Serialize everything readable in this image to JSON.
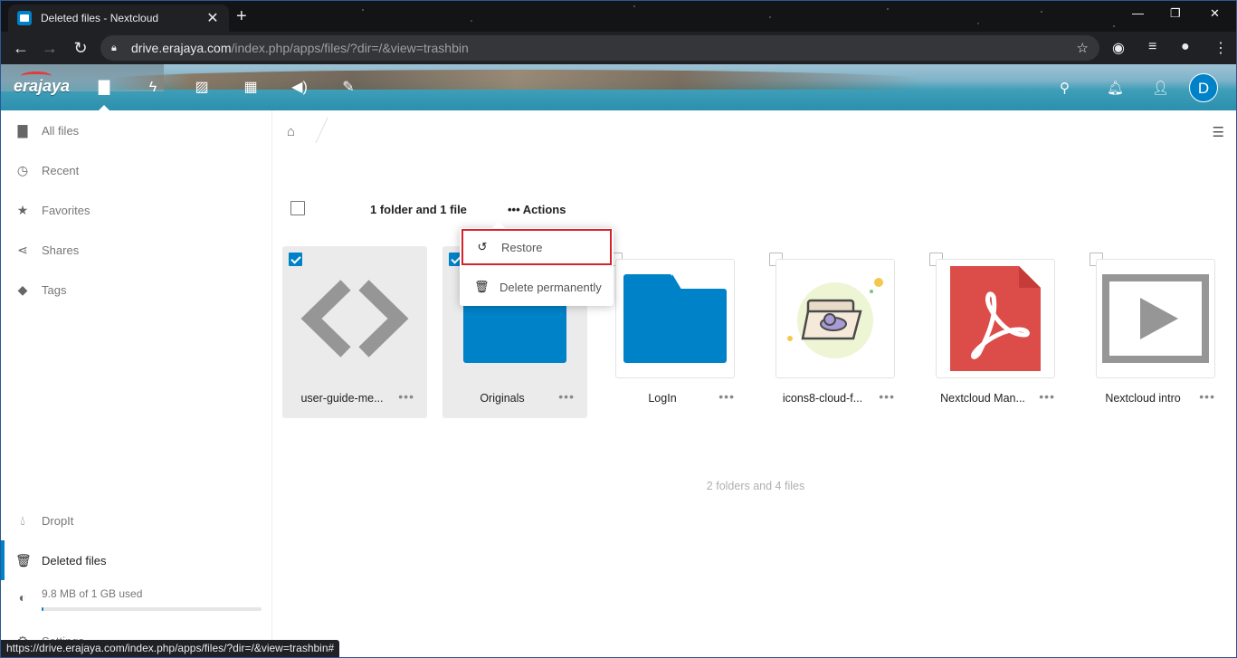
{
  "browser": {
    "tab_title": "Deleted files - Nextcloud",
    "tab_close": "✕",
    "new_tab": "+",
    "url_host": "drive.erajaya.com",
    "url_path": "/index.php/apps/files/?dir=/&view=trashbin",
    "status_url": "https://drive.erajaya.com/index.php/apps/files/?dir=/&view=trashbin#"
  },
  "header": {
    "logo_text": "erajaya",
    "avatar_letter": "D"
  },
  "sidebar": {
    "items": [
      {
        "label": "All files",
        "icon": "folder-icon"
      },
      {
        "label": "Recent",
        "icon": "clock-icon"
      },
      {
        "label": "Favorites",
        "icon": "star-icon"
      },
      {
        "label": "Shares",
        "icon": "share-icon"
      },
      {
        "label": "Tags",
        "icon": "tag-icon"
      }
    ],
    "dropit": "DropIt",
    "deleted": "Deleted files",
    "quota": "9.8 MB of 1 GB used",
    "quota_fraction": 0.01,
    "settings": "Settings"
  },
  "toolbar": {
    "selection_count": "1 folder and 1 file",
    "actions_label": "Actions"
  },
  "actions_menu": {
    "restore": "Restore",
    "delete": "Delete permanently"
  },
  "files": [
    {
      "name": "user-guide-me...",
      "selected": true,
      "type": "code"
    },
    {
      "name": "Originals",
      "selected": true,
      "type": "folder"
    },
    {
      "name": "LogIn",
      "selected": false,
      "type": "folder"
    },
    {
      "name": "icons8-cloud-f...",
      "selected": false,
      "type": "image"
    },
    {
      "name": "Nextcloud Man...",
      "selected": false,
      "type": "pdf"
    },
    {
      "name": "Nextcloud intro",
      "selected": false,
      "type": "video"
    }
  ],
  "summary": "2 folders and 4 files",
  "colors": {
    "accent": "#0082c9",
    "highlight_border": "#d7222a",
    "pdf": "#dc4c48"
  }
}
